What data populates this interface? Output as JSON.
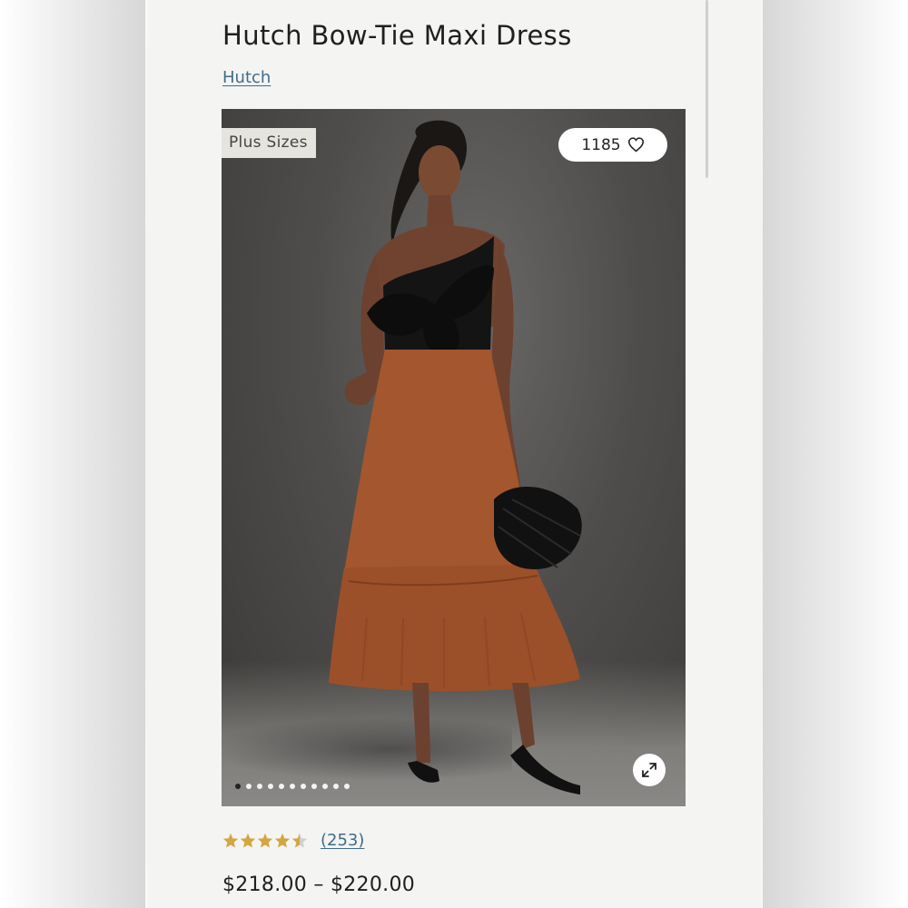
{
  "product": {
    "title": "Hutch Bow-Tie Maxi Dress",
    "brand": "Hutch",
    "price_range": "$218.00 – $220.00"
  },
  "image": {
    "badge": "Plus Sizes",
    "favorites_count": "1185",
    "gallery_count": 11,
    "active_index": 0,
    "colors": {
      "background": "#4f4d4b",
      "dress_skirt": "#a4562e",
      "dress_bodice": "#141414",
      "bag": "#111111"
    }
  },
  "reviews": {
    "rating": 4.5,
    "max": 5,
    "count_label": "(253)",
    "star_color": "#d4a640"
  },
  "colors": {
    "link": "#3f6c8c",
    "screen_bg": "#f4f4f2"
  }
}
